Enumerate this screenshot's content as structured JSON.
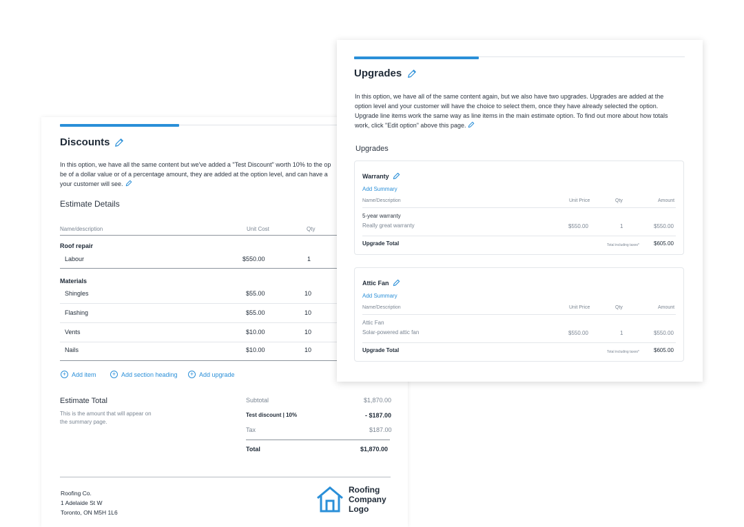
{
  "discounts": {
    "title": "Discounts",
    "description_lines": [
      "In this option, we have all the same content but we've added a \"Test Discount\" worth 10% to the op",
      "be of a dollar value or of a percentage amount, they are added at the option level, and can have a",
      "your customer will see."
    ],
    "estimate_details_heading": "Estimate Details",
    "columns": {
      "name": "Name/description",
      "unit_cost": "Unit Cost",
      "qty": "Qty"
    },
    "sections": [
      {
        "heading": "Roof repair",
        "items": [
          {
            "name": "Labour",
            "unit_cost": "$550.00",
            "qty": "1"
          }
        ]
      },
      {
        "heading": "Materials",
        "items": [
          {
            "name": "Shingles",
            "unit_cost": "$55.00",
            "qty": "10"
          },
          {
            "name": "Flashing",
            "unit_cost": "$55.00",
            "qty": "10"
          },
          {
            "name": "Vents",
            "unit_cost": "$10.00",
            "qty": "10"
          },
          {
            "name": "Nails",
            "unit_cost": "$10.00",
            "qty": "10"
          }
        ]
      }
    ],
    "actions": {
      "add_item": "Add item",
      "add_section_heading": "Add section heading",
      "add_upgrade": "Add upgrade"
    },
    "estimate_total": {
      "heading": "Estimate Total",
      "note_lines": [
        "This is the amount that will appear on",
        "the summary page."
      ],
      "subtotal_label": "Subtotal",
      "subtotal_value": "$1,870.00",
      "discount_label": "Test discount | 10%",
      "discount_value": "- $187.00",
      "tax_label": "Tax",
      "tax_value": "$187.00",
      "total_label": "Total",
      "total_value": "$1,870.00"
    },
    "company": {
      "address_lines": [
        "Roofing Co.",
        "1 Adelaide St W",
        "Toronto, ON M5H 1L6"
      ],
      "logo_lines": [
        "Roofing",
        "Company",
        "Logo"
      ]
    }
  },
  "upgrades": {
    "title": "Upgrades",
    "description_lines": [
      "In this option, we have all of the same content again, but we also have two upgrades. Upgrades are added at the",
      "option level and your customer will have the choice to select them, once they have already selected the option.",
      "Upgrade line items work the same way as line items in the main estimate option. To find out more about how totals",
      "work, click \"Edit option\" above this page."
    ],
    "section_heading": "Upgrades",
    "columns": {
      "name": "Name/Description",
      "unit_price": "Unit Price",
      "qty": "Qty",
      "amount": "Amount"
    },
    "add_summary_label": "Add Summary",
    "upgrade_total_label": "Upgrade Total",
    "total_incl_taxes_label": "Total including taxes*",
    "items": [
      {
        "title": "Warranty",
        "line_name": "5-year warranty",
        "line_desc": "Really great warranty",
        "unit_price": "$550.00",
        "qty": "1",
        "amount": "$550.00",
        "total": "$605.00"
      },
      {
        "title": "Attic Fan",
        "line_name": "Attic Fan",
        "line_desc": "Solar-powered attic fan",
        "unit_price": "$550.00",
        "qty": "1",
        "amount": "$550.00",
        "total": "$605.00"
      }
    ]
  },
  "colors": {
    "accent": "#2a8fd8",
    "text": "#1f2a37",
    "muted": "#7a8592"
  },
  "icons": {
    "edit": "pencil-icon",
    "add": "plus-circle-icon",
    "logo": "house-icon"
  }
}
